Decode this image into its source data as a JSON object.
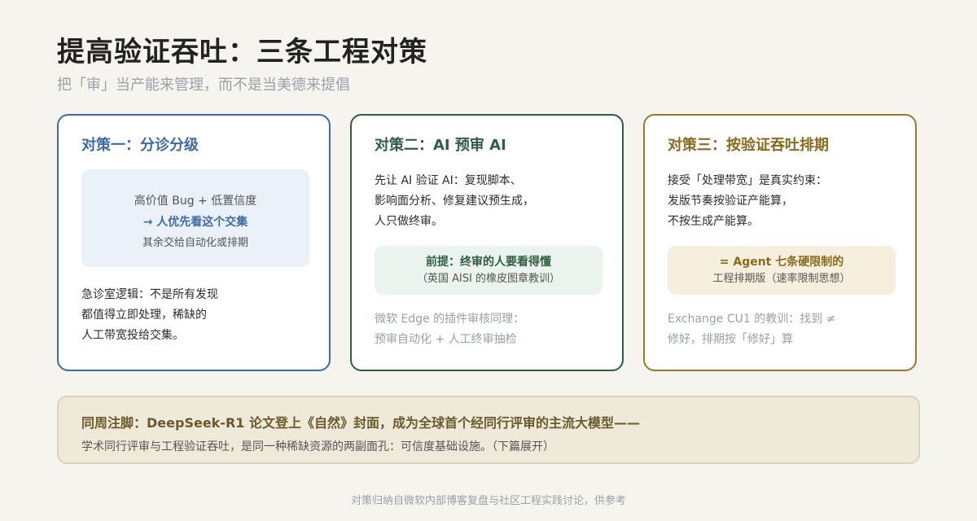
{
  "header": {
    "title": "提高验证吞吐：三条工程对策",
    "subtitle": "把「审」当产能来管理，而不是当美德来提倡"
  },
  "cards": [
    {
      "title": "对策一：分诊分级",
      "box": {
        "line1": "高价值 Bug + 低置信度",
        "line2": "→ 人优先看这个交集",
        "line3": "其余交给自动化或排期"
      },
      "body": [
        "急诊室逻辑：不是所有发现",
        "都值得立即处理，稀缺的",
        "人工带宽投给交集。"
      ]
    },
    {
      "title": "对策二：AI 预审 AI",
      "body": [
        "先让 AI 验证 AI：复现脚本、",
        "影响面分析、修复建议预生成，",
        "人只做终审。"
      ],
      "box": {
        "line1": "前提：终审的人要看得懂",
        "line2": "（英国 AISI 的橡皮图章教训）"
      },
      "note": [
        "微软 Edge 的插件审核同理：",
        "预审自动化 + 人工终审抽检"
      ]
    },
    {
      "title": "对策三：按验证吞吐排期",
      "body": [
        "接受「处理带宽」是真实约束：",
        "发版节奏按验证产能算，",
        "不按生成产能算。"
      ],
      "box": {
        "line1": "= Agent 七条硬限制的",
        "line2": "工程排期版（速率限制思想）"
      },
      "note": [
        "Exchange CU1 的教训：找到 ≠",
        "修好，排期按「修好」算"
      ]
    }
  ],
  "footer": {
    "line1": "同周注脚：DeepSeek-R1 论文登上《自然》封面，成为全球首个经同行评审的主流大模型——",
    "line2": "学术同行评审与工程验证吞吐，是同一种稀缺资源的两副面孔：可信度基础设施。（下篇展开）"
  },
  "source": "对策归纳自微软内部博客复盘与社区工程实践讨论，供参考",
  "colors": {
    "card1_accent": "#3f6aa8",
    "card2_accent": "#2f5e43",
    "card3_accent": "#9a7a2a",
    "background": "#f6f4ef"
  }
}
